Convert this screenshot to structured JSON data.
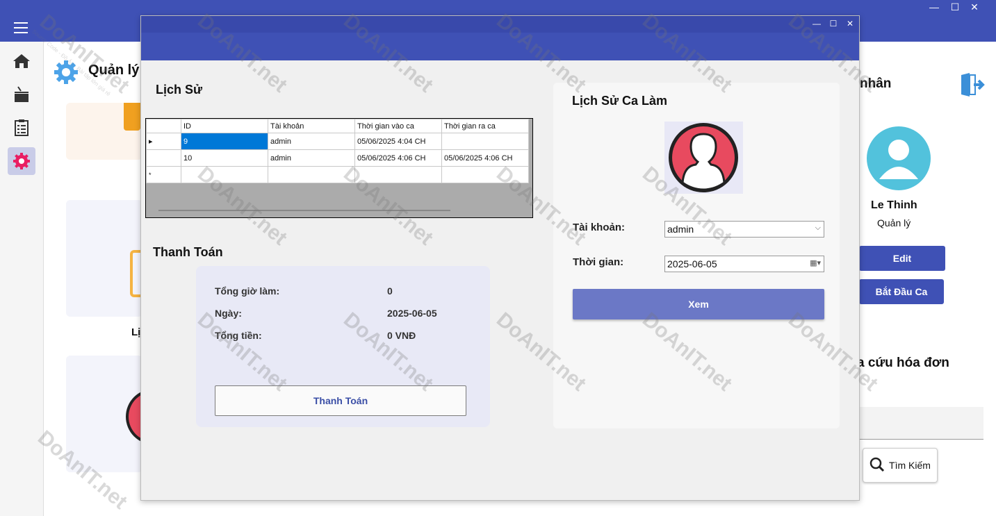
{
  "background": {
    "header_title": "Quản lý",
    "right_panel": {
      "section_title": "nhân",
      "user_name": "Le Thinh",
      "user_role": "Quản lý",
      "edit_label": "Edit",
      "start_shift_label": "Bắt Đầu Ca",
      "lookup_title": "a cứu hóa đơn",
      "search_label": "Tìm Kiếm"
    },
    "left_card_label": "Lị"
  },
  "dialog": {
    "history": {
      "title": "Lịch Sử",
      "columns": [
        "ID",
        "Tài khoản",
        "Thời gian vào ca",
        "Thời gian ra ca"
      ],
      "rows": [
        {
          "id": "9",
          "account": "admin",
          "start": "05/06/2025 4:04 CH",
          "end": ""
        },
        {
          "id": "10",
          "account": "admin",
          "start": "05/06/2025 4:06 CH",
          "end": "05/06/2025 4:06 CH"
        }
      ],
      "new_row_marker": "*"
    },
    "payment": {
      "title": "Thanh Toán",
      "total_hours_label": "Tổng giờ làm:",
      "total_hours_value": "0",
      "date_label": "Ngày:",
      "date_value": "2025-06-05",
      "total_money_label": "Tổng tiền:",
      "total_money_value": "0 VNĐ",
      "pay_button": "Thanh Toán"
    },
    "shift_history": {
      "title": "Lịch Sử Ca Làm",
      "account_label": "Tài khoản:",
      "account_value": "admin",
      "time_label": "Thời gian:",
      "time_value": "2025-06-05",
      "view_button": "Xem"
    }
  },
  "watermark": {
    "text": "DoAnIT.net",
    "subtext": "Source Code - Đồ Án - Bài tập lớn giá rẻ"
  },
  "colors": {
    "primary": "#3f51b5",
    "accent_button": "#6b78c6",
    "selection": "#0078d7",
    "avatar_red": "#e84a5f",
    "avatar_blue": "#52c2dc"
  }
}
